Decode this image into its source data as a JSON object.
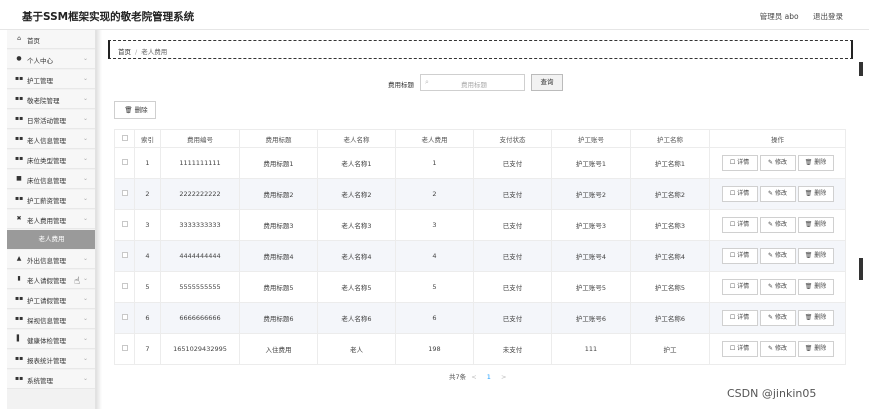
{
  "header": {
    "title": "基于SSM框架实现的敬老院管理系统",
    "admin": "管理员 abo",
    "logout": "退出登录"
  },
  "sidebar": {
    "items": [
      {
        "icon": "home-icon",
        "glyph": "⌂",
        "label": "首页"
      },
      {
        "icon": "user-icon",
        "glyph": "●",
        "label": "个人中心"
      },
      {
        "icon": "grid-icon",
        "glyph": "▪▪",
        "label": "护工管理"
      },
      {
        "icon": "grid-icon",
        "glyph": "▪▪",
        "label": "敬老院管理"
      },
      {
        "icon": "grid-icon",
        "glyph": "▪▪",
        "label": "日常活动管理"
      },
      {
        "icon": "grid-icon",
        "glyph": "▪▪",
        "label": "老人信息管理"
      },
      {
        "icon": "grid-icon",
        "glyph": "▪▪",
        "label": "床位类型管理"
      },
      {
        "icon": "checkbox-icon",
        "glyph": "■",
        "label": "床位信息管理"
      },
      {
        "icon": "grid-icon",
        "glyph": "▪▪",
        "label": "护工薪资管理"
      },
      {
        "icon": "money-icon",
        "glyph": "✖",
        "label": "老人费用管理"
      }
    ],
    "active_sub": "老人费用",
    "items_after": [
      {
        "icon": "car-icon",
        "glyph": "▲",
        "label": "外出信息管理"
      },
      {
        "icon": "file-icon",
        "glyph": "▮",
        "label": "老人请假管理"
      },
      {
        "icon": "grid-icon",
        "glyph": "▪▪",
        "label": "护工请假管理"
      },
      {
        "icon": "grid-icon",
        "glyph": "▪▪",
        "label": "探视信息管理"
      },
      {
        "icon": "bar-chart-icon",
        "glyph": "▌",
        "label": "健康体检管理"
      },
      {
        "icon": "grid-icon",
        "glyph": "▪▪",
        "label": "报表统计管理"
      },
      {
        "icon": "grid-icon",
        "glyph": "▪▪",
        "label": "系统管理"
      }
    ]
  },
  "breadcrumb": {
    "home": "首页",
    "current": "老人费用"
  },
  "search": {
    "label": "费用标题",
    "placeholder": "费用标题",
    "button": "查询"
  },
  "toolbar": {
    "delete_label": "删除"
  },
  "table": {
    "headers": [
      "索引",
      "费用编号",
      "费用标题",
      "老人名称",
      "老人费用",
      "支付状态",
      "护工账号",
      "护工名称",
      "操作"
    ],
    "rows": [
      [
        "1",
        "1111111111",
        "费用标题1",
        "老人名称1",
        "1",
        "已支付",
        "护工账号1",
        "护工名称1"
      ],
      [
        "2",
        "2222222222",
        "费用标题2",
        "老人名称2",
        "2",
        "已支付",
        "护工账号2",
        "护工名称2"
      ],
      [
        "3",
        "3333333333",
        "费用标题3",
        "老人名称3",
        "3",
        "已支付",
        "护工账号3",
        "护工名称3"
      ],
      [
        "4",
        "4444444444",
        "费用标题4",
        "老人名称4",
        "4",
        "已支付",
        "护工账号4",
        "护工名称4"
      ],
      [
        "5",
        "5555555555",
        "费用标题5",
        "老人名称5",
        "5",
        "已支付",
        "护工账号5",
        "护工名称5"
      ],
      [
        "6",
        "6666666666",
        "费用标题6",
        "老人名称6",
        "6",
        "已支付",
        "护工账号6",
        "护工名称6"
      ],
      [
        "7",
        "1651029432995",
        "入住费用",
        "老人",
        "198",
        "未支付",
        "111",
        "护工"
      ]
    ],
    "ops": [
      "详情",
      "修改",
      "删除"
    ]
  },
  "pager": {
    "total": "共7条",
    "page": "1",
    "prev": "<",
    "next": ">"
  },
  "watermark": "CSDN @jinkin05"
}
